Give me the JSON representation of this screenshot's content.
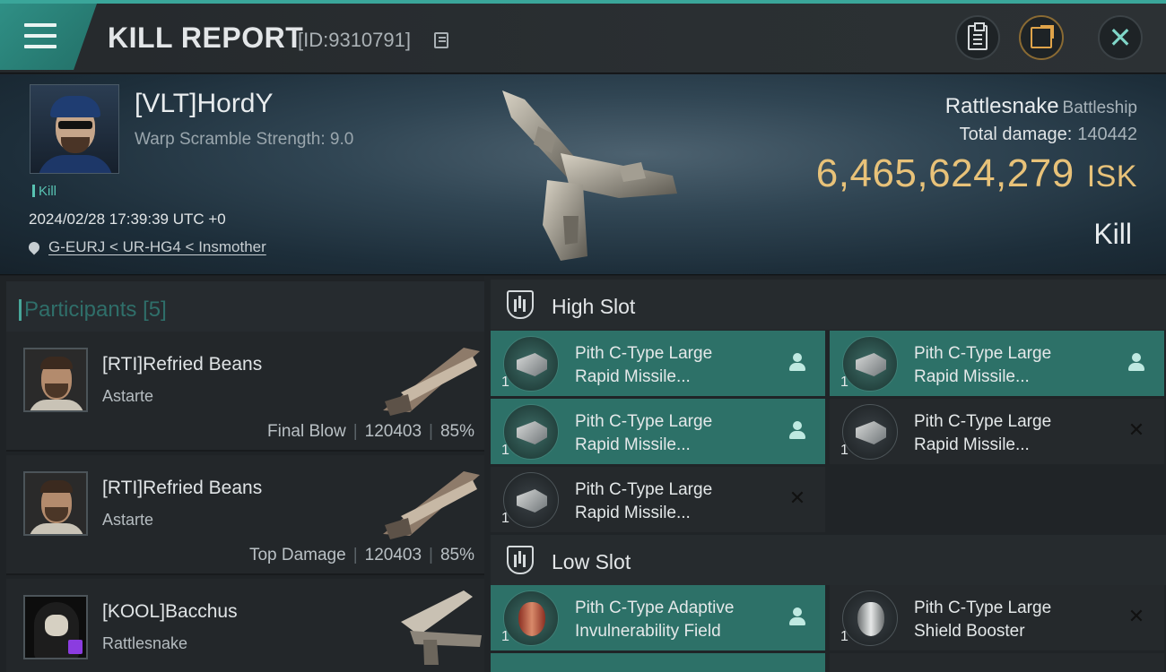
{
  "header": {
    "title": "KILL REPORT",
    "report_id": "[ID:9310791]"
  },
  "victim": {
    "pilot": "[VLT]HordY",
    "warp_scramble": "Warp Scramble Strength: 9.0",
    "tag": "Kill",
    "timestamp": "2024/02/28 17:39:39 UTC +0",
    "location": "G-EURJ < UR-HG4 < Insmother",
    "ship_name": "Rattlesnake",
    "ship_class": "Battleship",
    "total_damage_label": "Total damage:",
    "total_damage": "140442",
    "isk_value": "6,465,624,279",
    "isk_unit": "ISK",
    "outcome": "Kill"
  },
  "participants": {
    "label": "Participants",
    "count": "[5]",
    "items": [
      {
        "name": "[RTI]Refried Beans",
        "ship": "Astarte",
        "role": "Final Blow",
        "damage": "120403",
        "percent": "85%"
      },
      {
        "name": "[RTI]Refried Beans",
        "ship": "Astarte",
        "role": "Top Damage",
        "damage": "120403",
        "percent": "85%"
      },
      {
        "name": "[KOOL]Bacchus",
        "ship": "Rattlesnake"
      }
    ]
  },
  "slots": {
    "high": {
      "label": "High Slot",
      "modules": [
        {
          "line1": "Pith C-Type Large",
          "line2": "Rapid Missile...",
          "qty": "1",
          "state": "dropped"
        },
        {
          "line1": "Pith C-Type Large",
          "line2": "Rapid Missile...",
          "qty": "1",
          "state": "dropped"
        },
        {
          "line1": "Pith C-Type Large",
          "line2": "Rapid Missile...",
          "qty": "1",
          "state": "dropped"
        },
        {
          "line1": "Pith C-Type Large",
          "line2": "Rapid Missile...",
          "qty": "1",
          "state": "destroyed"
        },
        {
          "line1": "Pith C-Type Large",
          "line2": "Rapid Missile...",
          "qty": "1",
          "state": "destroyed"
        }
      ]
    },
    "low": {
      "label": "Low Slot",
      "modules": [
        {
          "line1": "Pith C-Type Adaptive",
          "line2": "Invulnerability Field",
          "qty": "1",
          "state": "dropped"
        },
        {
          "line1": "Pith C-Type Large",
          "line2": "Shield Booster",
          "qty": "1",
          "state": "destroyed"
        }
      ]
    }
  },
  "colors": {
    "accent": "#2d7168",
    "isk": "#e8c279",
    "header_bar": "#3aa69a"
  }
}
